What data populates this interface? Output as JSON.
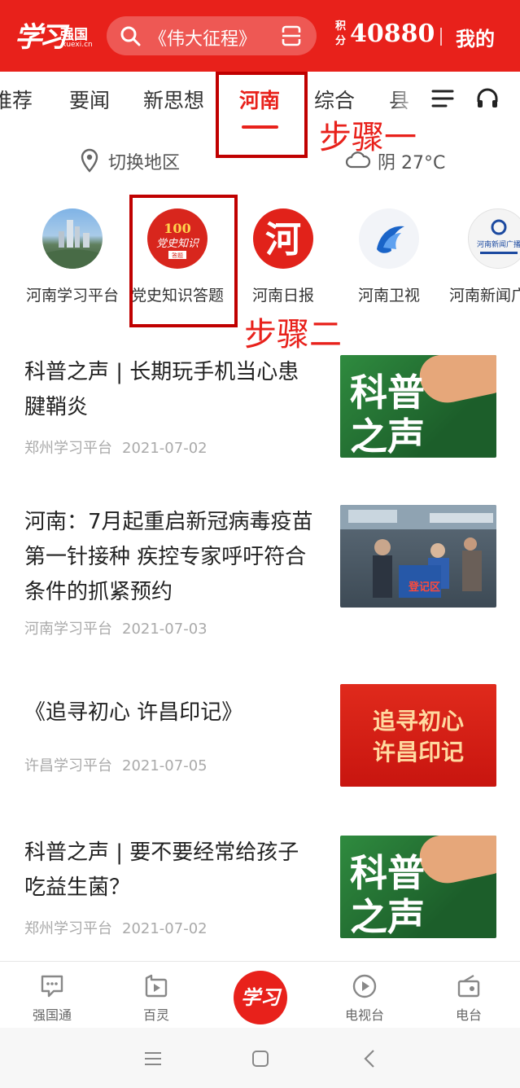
{
  "header": {
    "logo_script": "学习",
    "logo_name": "强国",
    "logo_domain": "xuexi.cn",
    "search_text": "《伟大征程》",
    "points_label": "积分",
    "points_value": "40880",
    "mine_label": "我的",
    "colors": {
      "brand": "#e8211b"
    }
  },
  "tabs": {
    "items": [
      "推荐",
      "要闻",
      "新思想",
      "河南",
      "综合",
      "县"
    ],
    "active": "河南"
  },
  "annotations": {
    "step1": "步骤一",
    "step2": "步骤二"
  },
  "region": {
    "switch_label": "切换地区",
    "weather": "阴 27°C"
  },
  "channels": [
    {
      "label": "河南学习平台",
      "icon": "henan-study-platform-logo"
    },
    {
      "label": "党史知识答题",
      "icon": "party-history-quiz-logo",
      "logo_text": "党史知识",
      "logo_sub": "答题",
      "logo_num": "100"
    },
    {
      "label": "河南日报",
      "icon": "henan-daily-logo",
      "logo_text": "河"
    },
    {
      "label": "河南卫视",
      "icon": "henan-tv-logo"
    },
    {
      "label": "河南新闻广",
      "icon": "henan-news-radio-logo",
      "logo_text": "河南新闻广播"
    }
  ],
  "articles": [
    {
      "title": "科普之声 | 长期玩手机当心患腱鞘炎",
      "source": "郑州学习平台",
      "date": "2021-07-02",
      "thumb_text": [
        "科普",
        "之声"
      ]
    },
    {
      "title": "河南：7月起重启新冠病毒疫苗第一针接种 疾控专家呼吁符合条件的抓紧预约",
      "source": "河南学习平台",
      "date": "2021-07-03",
      "thumb_sign": "登记区"
    },
    {
      "title": "《追寻初心 许昌印记》",
      "source": "许昌学习平台",
      "date": "2021-07-05",
      "thumb_text": [
        "追寻初心",
        "许昌印记"
      ]
    },
    {
      "title": "科普之声 | 要不要经常给孩子吃益生菌？",
      "source": "郑州学习平台",
      "date": "2021-07-02",
      "thumb_text": [
        "科普",
        "之声"
      ]
    }
  ],
  "bottom_nav": [
    {
      "label": "强国通",
      "icon": "chat-icon"
    },
    {
      "label": "百灵",
      "icon": "short-video-icon"
    },
    {
      "label": "学习",
      "icon": "study-center-icon"
    },
    {
      "label": "电视台",
      "icon": "play-icon"
    },
    {
      "label": "电台",
      "icon": "radio-icon"
    }
  ]
}
